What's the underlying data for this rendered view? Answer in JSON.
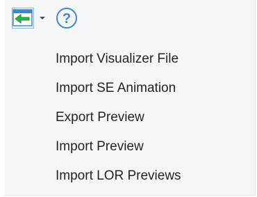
{
  "toolbar": {
    "primary_button_icon": "import-export-arrow-icon",
    "dropdown_icon": "chevron-down-icon",
    "help_icon": "help-question-icon",
    "help_symbol": "?"
  },
  "menu": {
    "items": [
      {
        "label": "Import Visualizer File"
      },
      {
        "label": "Import SE Animation"
      },
      {
        "label": "Export Preview"
      },
      {
        "label": "Import Preview"
      },
      {
        "label": "Import LOR Previews"
      }
    ]
  },
  "colors": {
    "panel_background": "#f5f6f7",
    "text": "#1f2328",
    "arrow_green": "#2db34a",
    "icon_blue": "#3f86cc",
    "border_blue": "#8fb4d8"
  }
}
